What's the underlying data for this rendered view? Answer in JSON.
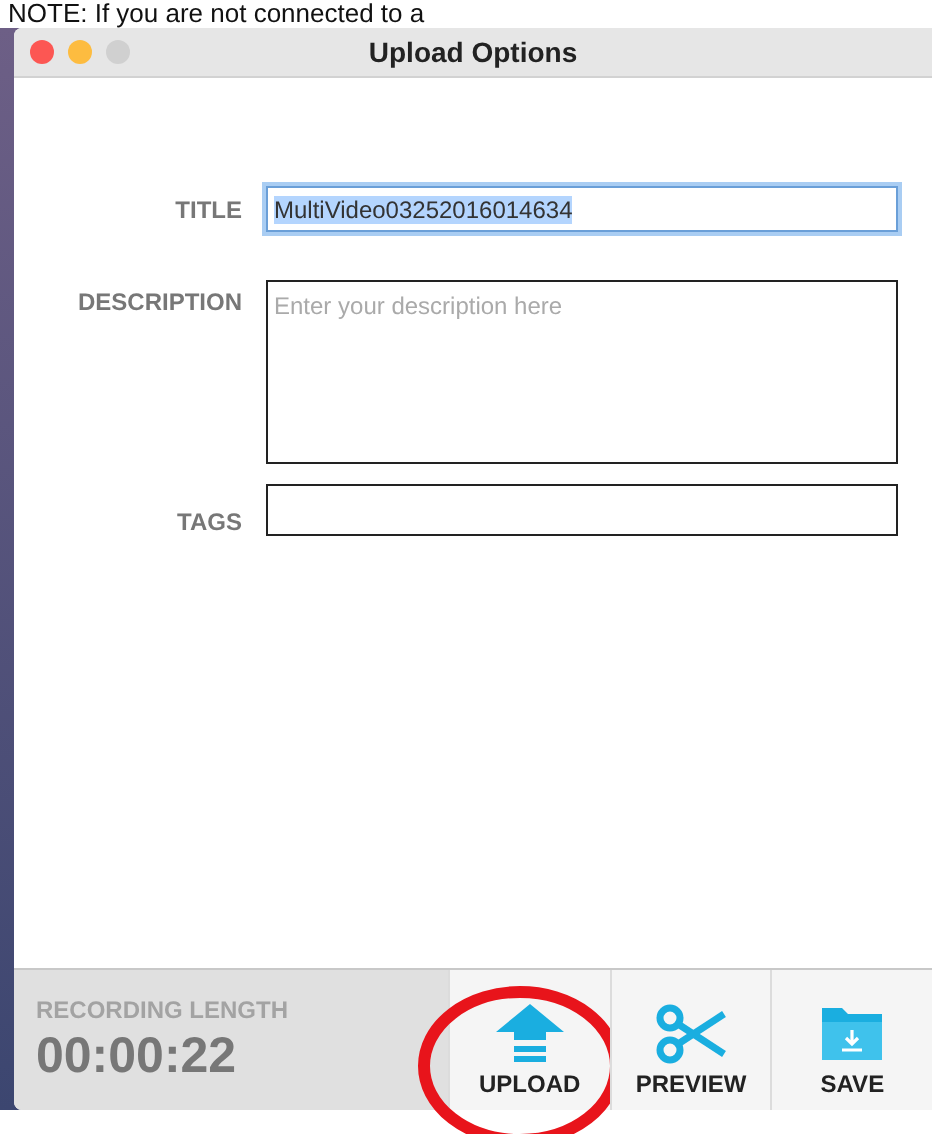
{
  "note": "NOTE: If you are not connected to a",
  "window": {
    "title": "Upload Options"
  },
  "fields": [
    {
      "label": "TITLE",
      "kind": "text",
      "value": "MultiVideo03252016014634",
      "focused": true
    },
    {
      "label": "DESCRIPTION",
      "kind": "textarea",
      "placeholder": "Enter your description here",
      "focused": false
    },
    {
      "label": "TAGS",
      "kind": "text",
      "focused": false
    }
  ],
  "recording_length": {
    "label": "RECORDING LENGTH",
    "value": "00:00:22"
  },
  "buttons": [
    {
      "label": "UPLOAD",
      "kind": "upload",
      "highlighted": true
    },
    {
      "label": "PREVIEW",
      "kind": "preview",
      "highlighted": false
    },
    {
      "label": "SAVE",
      "kind": "save",
      "highlighted": false
    }
  ]
}
